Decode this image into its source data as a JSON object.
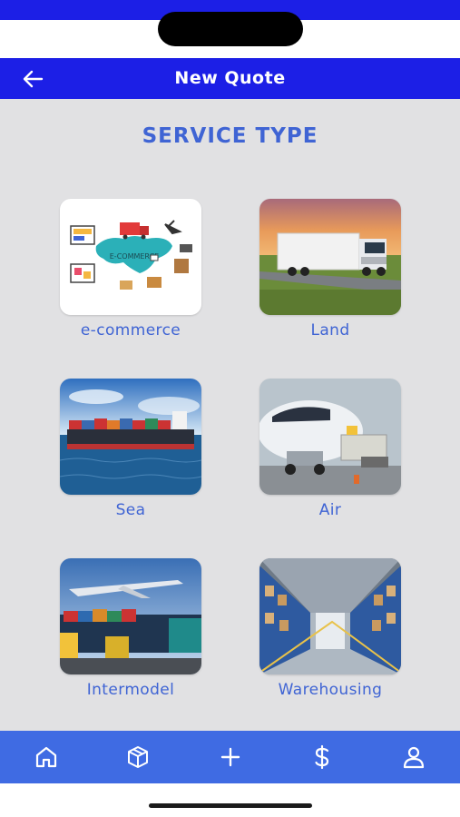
{
  "header": {
    "title": "New Quote"
  },
  "main": {
    "section_title": "SERVICE TYPE",
    "services": [
      {
        "label": "e-commerce",
        "image_text": "E-COMMERCE"
      },
      {
        "label": "Land"
      },
      {
        "label": "Sea"
      },
      {
        "label": "Air"
      },
      {
        "label": "Intermodel"
      },
      {
        "label": "Warehousing"
      }
    ]
  },
  "bottom_nav": {
    "items": [
      {
        "icon": "home-icon"
      },
      {
        "icon": "package-icon"
      },
      {
        "icon": "plus-icon"
      },
      {
        "icon": "dollar-icon"
      },
      {
        "icon": "user-icon"
      }
    ]
  },
  "colors": {
    "header": "#1c1fe6",
    "accent": "#3f64d4",
    "nav": "#3f6be3",
    "background": "#e1e1e3"
  }
}
